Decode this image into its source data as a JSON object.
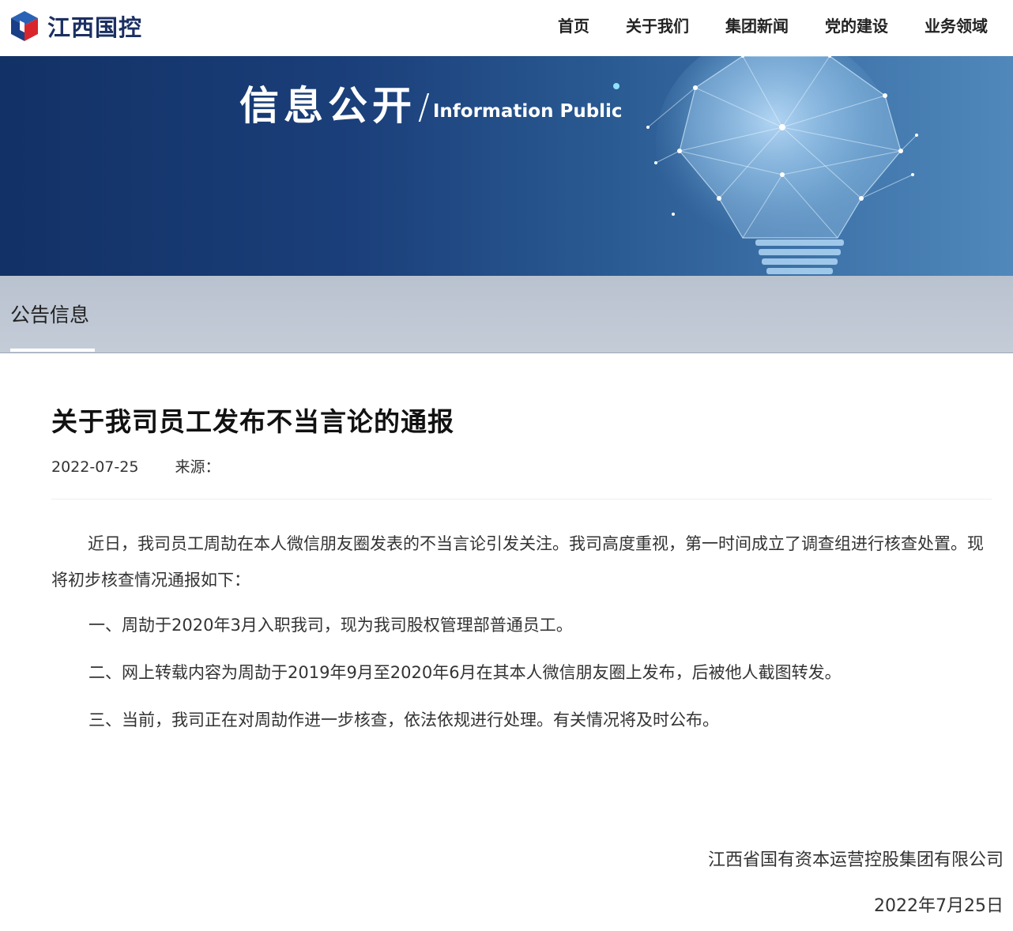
{
  "header": {
    "logo_text": "江西国控",
    "nav": [
      "首页",
      "关于我们",
      "集团新闻",
      "党的建设",
      "业务领域"
    ]
  },
  "banner": {
    "title_cn": "信息公开",
    "slash": "/",
    "title_en": "Information Public"
  },
  "section": {
    "title": "公告信息"
  },
  "article": {
    "title": "关于我司员工发布不当言论的通报",
    "date": "2022-07-25",
    "source_label": "来源：",
    "paragraphs": [
      "近日，我司员工周劼在本人微信朋友圈发表的不当言论引发关注。我司高度重视，第一时间成立了调查组进行核查处置。现将初步核查情况通报如下：",
      "一、周劼于2020年3月入职我司，现为我司股权管理部普通员工。",
      "二、网上转载内容为周劼于2019年9月至2020年6月在其本人微信朋友圈上发布，后被他人截图转发。",
      "三、当前，我司正在对周劼作进一步核查，依法依规进行处理。有关情况将及时公布。"
    ],
    "signature_org": "江西省国有资本运营控股集团有限公司",
    "signature_date": "2022年7月25日"
  },
  "colors": {
    "brand": "#1b2f62",
    "banner_dark": "#123166",
    "banner_light": "#5088bb",
    "subbar": "#c0c8d4",
    "logo_red": "#d9262c"
  }
}
